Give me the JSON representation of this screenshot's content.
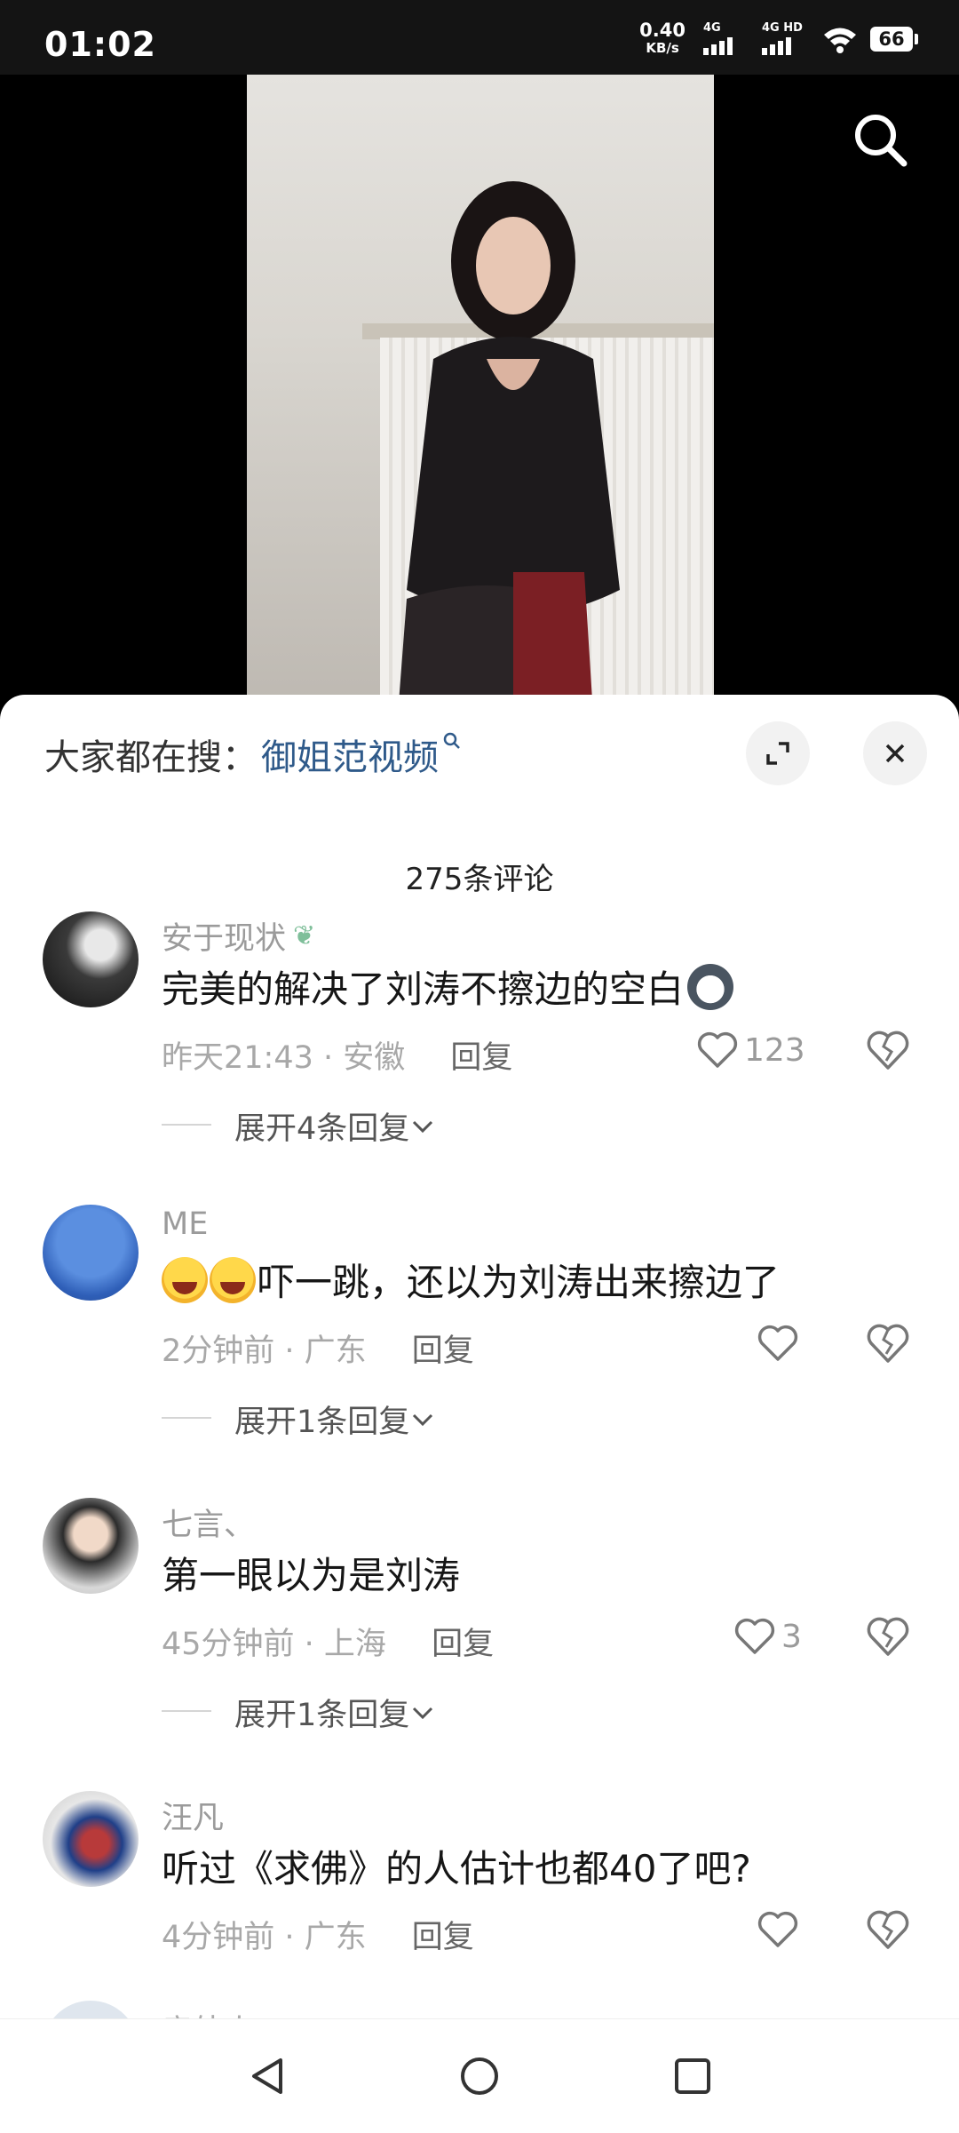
{
  "status_bar": {
    "time": "01:02",
    "net_speed_value": "0.40",
    "net_speed_unit": "KB/s",
    "sim1_label": "4G",
    "sim2_label": "4G HD",
    "battery": "66"
  },
  "video": {
    "search_icon": "search-icon"
  },
  "sheet": {
    "suggest_prefix": "大家都在搜：",
    "suggest_link": "御姐范视频",
    "suggest_icon": "search-mini-icon",
    "comment_count": "275条评论"
  },
  "comments": [
    {
      "user": "安于现状",
      "badge": "dragon-badge-icon",
      "text": "完美的解决了刘涛不擦边的空白",
      "emoji": "husky-emoji",
      "time_location": "昨天21:43 · 安徽",
      "reply": "回复",
      "likes": "123",
      "expand": "展开4条回复"
    },
    {
      "user": "ME",
      "text": "吓一跳，还以为刘涛出来擦边了",
      "emoji": "laughing-crying-emoji",
      "time_location": "2分钟前 · 广东",
      "reply": "回复",
      "likes": "",
      "expand": "展开1条回复"
    },
    {
      "user": "七言、",
      "text": "第一眼以为是刘涛",
      "time_location": "45分钟前 · 上海",
      "reply": "回复",
      "likes": "3",
      "expand": "展开1条回复"
    },
    {
      "user": "汪凡",
      "text": "听过《求佛》的人估计也都40了吧?",
      "time_location": "4分钟前 · 广东",
      "reply": "回复",
      "likes": ""
    }
  ],
  "next_comment_peek": "房外人",
  "nav": {
    "back": "back-icon",
    "home": "home-icon",
    "recents": "recents-icon"
  }
}
